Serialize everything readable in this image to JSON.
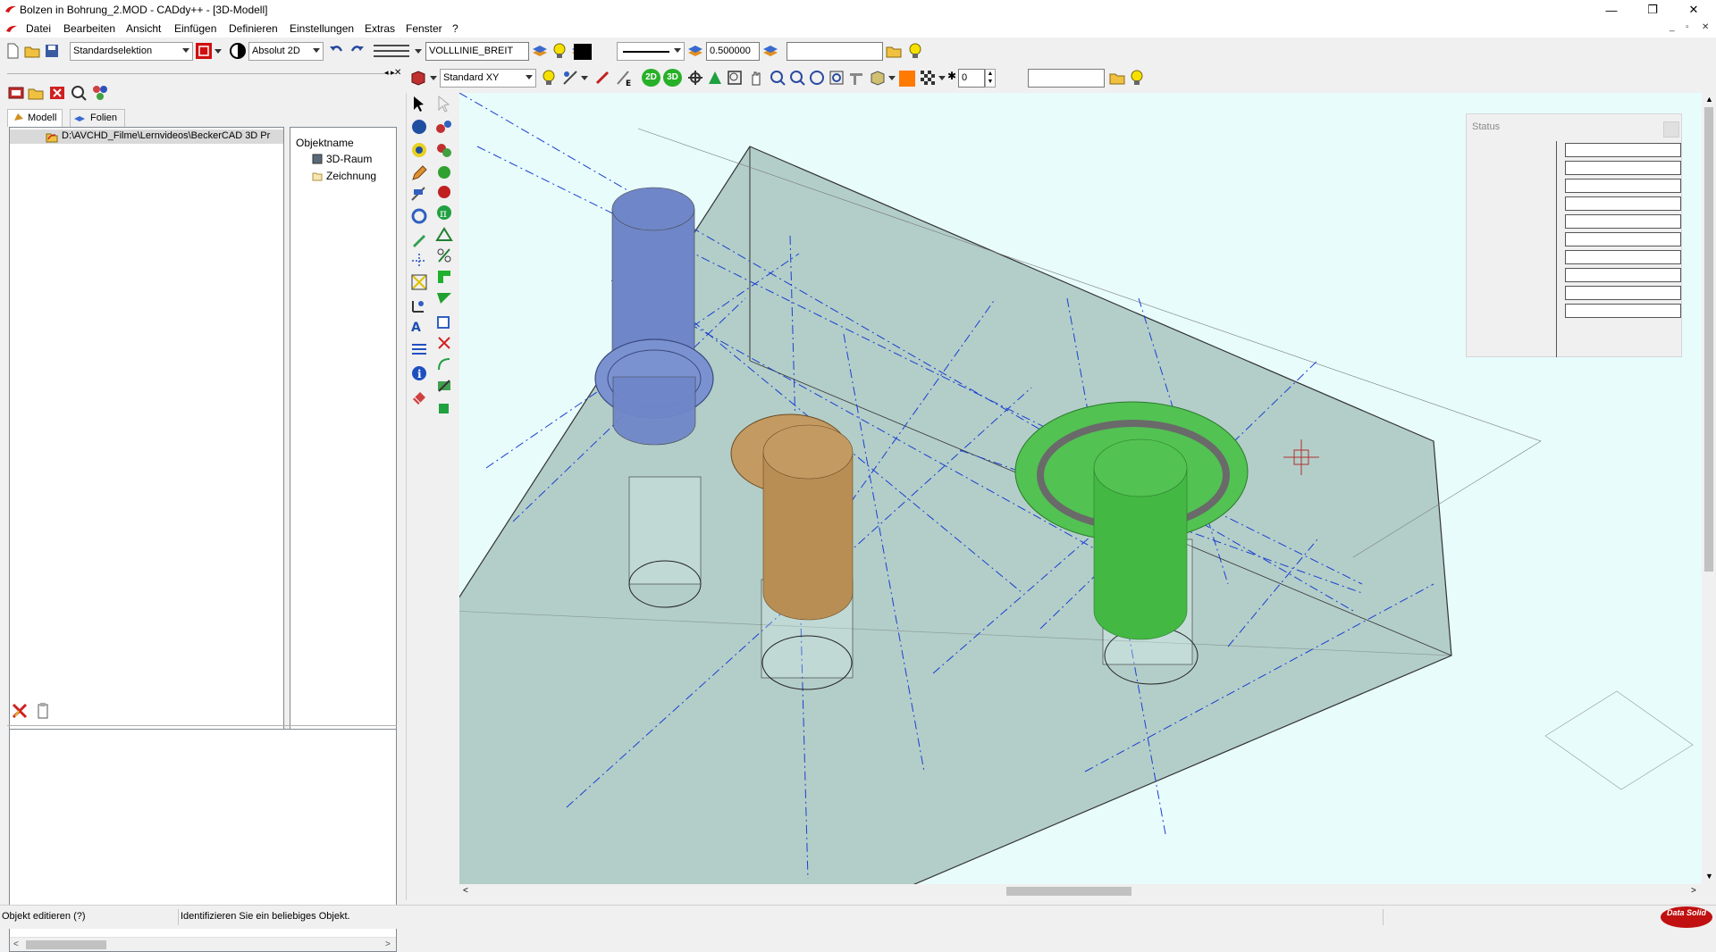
{
  "window": {
    "title": "Bolzen in Bohrung_2.MOD  -  CADdy++ - [3D-Modell]",
    "minimize": "—",
    "restore": "❐",
    "close": "✕",
    "mdi_minimize": "_",
    "mdi_restore": "▫",
    "mdi_close": "✕"
  },
  "menu": {
    "items": [
      "Datei",
      "Bearbeiten",
      "Ansicht",
      "Einfügen",
      "Definieren",
      "Einstellungen",
      "Extras",
      "Fenster",
      "?"
    ]
  },
  "toolbar1": {
    "selection_mode": "Standardselektion",
    "coord_mode": "Absolut 2D",
    "line_type": "VOLLLINIE_BREIT",
    "line_width": "0.500000",
    "layer_value": ""
  },
  "toolbar2": {
    "view_plane": "Standard XY",
    "view_2d_label": "2D",
    "view_3d_label": "3D",
    "layer_number": "0",
    "search_value": ""
  },
  "model_tree": {
    "tabs": [
      "Modell",
      "Folien"
    ],
    "root_path": "D:\\AVCHD_Filme\\Lernvideos\\BeckerCAD 3D Pr",
    "object_column_header": "Objektname",
    "objects": [
      "3D-Raum",
      "Zeichnung"
    ]
  },
  "status_panel": {
    "title": "Status",
    "field_count": 10
  },
  "statusbar": {
    "command": "Objekt editieren (?)",
    "prompt": "Identifizieren Sie ein beliebiges Objekt.",
    "logo_text": "Data Solid"
  },
  "colors": {
    "viewport_bg": "#e8fcfc",
    "block_fill": "#a9c6c0",
    "bolt_blue": "#6f87c8",
    "bolt_orange": "#c39a62",
    "bolt_green": "#52c252",
    "axis_blue": "#1a3fd0"
  }
}
